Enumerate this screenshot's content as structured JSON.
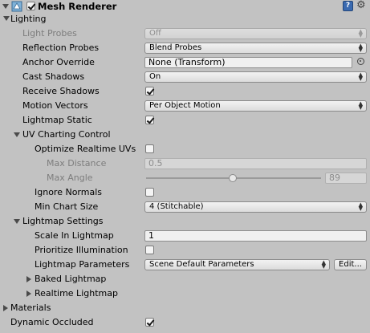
{
  "component": {
    "title": "Mesh Renderer",
    "enabled": true
  },
  "sections": {
    "lighting": "Lighting",
    "uv_charting": "UV Charting Control",
    "lightmap_settings": "Lightmap Settings",
    "baked_lightmap": "Baked Lightmap",
    "realtime_lightmap": "Realtime Lightmap",
    "materials": "Materials"
  },
  "fields": {
    "light_probes": {
      "label": "Light Probes",
      "value": "Off"
    },
    "reflection_probes": {
      "label": "Reflection Probes",
      "value": "Blend Probes"
    },
    "anchor_override": {
      "label": "Anchor Override",
      "value": "None (Transform)"
    },
    "cast_shadows": {
      "label": "Cast Shadows",
      "value": "On"
    },
    "receive_shadows": {
      "label": "Receive Shadows",
      "checked": true
    },
    "motion_vectors": {
      "label": "Motion Vectors",
      "value": "Per Object Motion"
    },
    "lightmap_static": {
      "label": "Lightmap Static",
      "checked": true
    },
    "optimize_realtime_uvs": {
      "label": "Optimize Realtime UVs",
      "checked": false
    },
    "max_distance": {
      "label": "Max Distance",
      "value": "0.5"
    },
    "max_angle": {
      "label": "Max Angle",
      "value": "89",
      "slider_fraction": 0.5
    },
    "ignore_normals": {
      "label": "Ignore Normals",
      "checked": false
    },
    "min_chart_size": {
      "label": "Min Chart Size",
      "value": "4 (Stitchable)"
    },
    "scale_in_lightmap": {
      "label": "Scale In Lightmap",
      "value": "1"
    },
    "prioritize_illumination": {
      "label": "Prioritize Illumination",
      "checked": false
    },
    "lightmap_parameters": {
      "label": "Lightmap Parameters",
      "value": "Scene Default Parameters",
      "edit_label": "Edit..."
    },
    "dynamic_occluded": {
      "label": "Dynamic Occluded",
      "checked": true
    }
  },
  "colors": {
    "background": "#c2c2c2",
    "disabled_text": "#7d7d7d"
  }
}
